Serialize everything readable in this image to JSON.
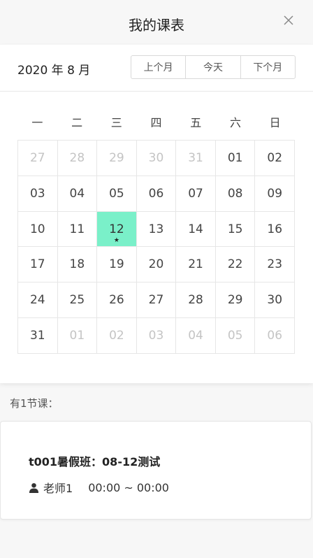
{
  "header": {
    "title": "我的课表"
  },
  "toolbar": {
    "month_label": "2020 年 8 月",
    "prev_label": "上个月",
    "today_label": "今天",
    "next_label": "下个月"
  },
  "weekdays": [
    "一",
    "二",
    "三",
    "四",
    "五",
    "六",
    "日"
  ],
  "calendar": {
    "weeks": [
      [
        "27",
        "28",
        "29",
        "30",
        "31",
        "01",
        "02"
      ],
      [
        "03",
        "04",
        "05",
        "06",
        "07",
        "08",
        "09"
      ],
      [
        "10",
        "11",
        "12",
        "13",
        "14",
        "15",
        "16"
      ],
      [
        "17",
        "18",
        "19",
        "20",
        "21",
        "22",
        "23"
      ],
      [
        "24",
        "25",
        "26",
        "27",
        "28",
        "29",
        "30"
      ],
      [
        "31",
        "01",
        "02",
        "03",
        "04",
        "05",
        "06"
      ]
    ],
    "selected_marker": "★",
    "selected_color": "#7af0c9"
  },
  "lessons": {
    "count_text": "有1节课：",
    "items": [
      {
        "title": "t001暑假班：08-12测试",
        "teacher": "老师1",
        "time": "00:00 ~ 00:00",
        "icon": "user-icon"
      }
    ]
  }
}
